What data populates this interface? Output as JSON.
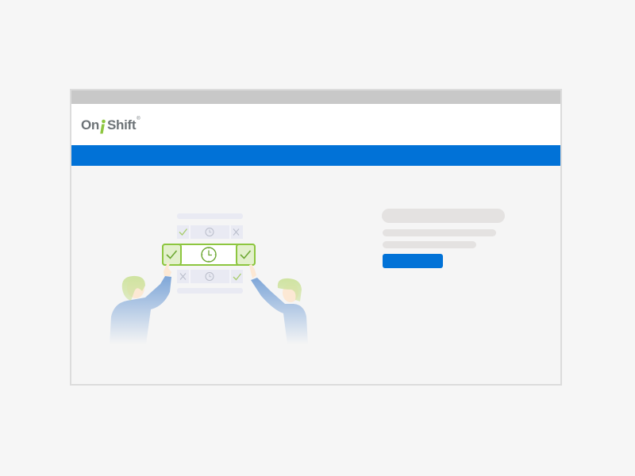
{
  "app": {
    "logo_text_left": "On",
    "logo_text_right": "Shift",
    "logo_trademark": "®"
  },
  "colors": {
    "brand_blue": "#0172d7",
    "brand_green": "#8dc63f",
    "logo_gray": "#6d7377",
    "titlebar_gray": "#c8c8c8",
    "skeleton_gray": "#e4e2e1"
  },
  "header": {
    "logo_icon": "onshift-person-icon"
  },
  "content": {
    "illustration_icons": [
      "check-icon",
      "clock-icon",
      "x-icon",
      "hand-pointing-icon",
      "person-illustration"
    ],
    "cta_label": ""
  }
}
